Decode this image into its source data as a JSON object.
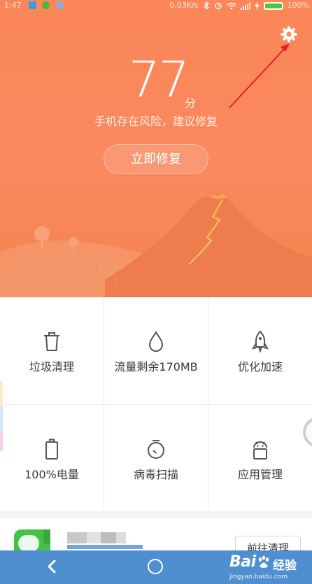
{
  "status_bar": {
    "time": "1:47",
    "network_speed": "0.03K/s",
    "battery_percent": "100%"
  },
  "header": {
    "score": "77",
    "score_unit": "分",
    "risk_message": "手机存在风险，建议修复",
    "fix_button_label": "立即修复",
    "settings_icon": "gear-icon",
    "accent_color": "#fb8658",
    "annotation_color": "#e8202a"
  },
  "tools": [
    {
      "label": "垃圾清理",
      "icon": "trash-icon"
    },
    {
      "label": "流量剩余170MB",
      "icon": "water-drop-icon"
    },
    {
      "label": "优化加速",
      "icon": "rocket-icon"
    },
    {
      "label": "100%电量",
      "icon": "battery-icon"
    },
    {
      "label": "病毒扫描",
      "icon": "timer-scan-icon"
    },
    {
      "label": "应用管理",
      "icon": "android-icon"
    }
  ],
  "card": {
    "app_icon": "wechat-icon",
    "button_label": "前往清理"
  },
  "nav": {
    "back_icon": "back-icon",
    "home_icon": "home-icon"
  },
  "watermark": {
    "brand": "Bai",
    "brand_cn": "经验",
    "url": "jingyan.baidu.com"
  }
}
